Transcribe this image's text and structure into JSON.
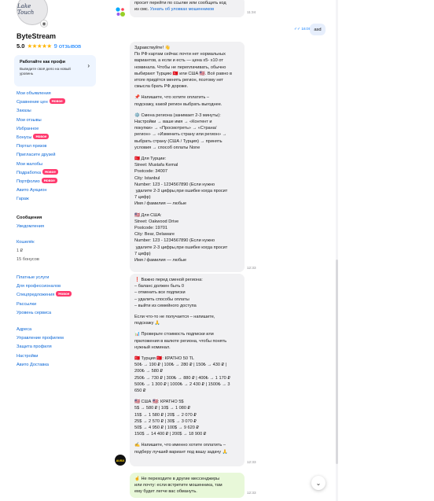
{
  "sidebar": {
    "avatar_text": "Lake Touch",
    "seller_name": "ByteStream",
    "rating_score": "5.0",
    "rating_stars": "★★★★★",
    "reviews": "9 отзывов",
    "promo_title": "Работайте как профи",
    "promo_desc": "Выведите своё дело на новый уровень",
    "menu1": [
      {
        "label": "Мои объявления"
      },
      {
        "label": "Сравнение цен",
        "badge": "Новое"
      },
      {
        "label": "Заказы"
      },
      {
        "label": "Мои отзывы"
      },
      {
        "label": "Избранное"
      },
      {
        "label": "Бонусы",
        "badge": "Новое"
      },
      {
        "label": "Портал призов"
      },
      {
        "label": "Пригласите друзей"
      },
      {
        "label": "Мои жалобы"
      },
      {
        "label": "Подработка",
        "badge": "Новое"
      },
      {
        "label": "Портфолио",
        "badge": "Новое"
      },
      {
        "label": "Авито Аукцион"
      },
      {
        "label": "Гараж"
      }
    ],
    "messages_heading": "Сообщения",
    "notifications": "Уведомления",
    "wallet_heading": "Кошелёк",
    "wallet_balance": "1 ₽",
    "bonuses": "15 бонусов",
    "menu2": [
      {
        "label": "Платные услуги"
      },
      {
        "label": "Для профессионалов"
      },
      {
        "label": "Спецпредложения",
        "badge": "Новое"
      },
      {
        "label": "Рассылки"
      },
      {
        "label": "Уровень сервиса"
      }
    ],
    "menu3": [
      {
        "label": "Адреса"
      },
      {
        "label": "Управление профилем"
      },
      {
        "label": "Защита профиля"
      },
      {
        "label": "Настройки"
      },
      {
        "label": "Авито Доставка"
      }
    ]
  },
  "chat": {
    "top_bubble": {
      "line1": "просит перейти по ссылке или сообщить код",
      "line2_text": "из смс. ",
      "line2_link": "Узнать об уловках мошенников",
      "time": "11:34"
    },
    "out_message": {
      "text": "asd",
      "status": "✓✓ 16:00"
    },
    "main_bubble": {
      "time": "12:33",
      "lines": [
        "Здравствуйте! 👋",
        "По РФ картам сейчас почти нет нормальных",
        "вариантов, а если и есть — цена х5- х10 от",
        "номинала. Чтобы не переплачивать, обычно",
        "выбирают Турцию 🇹🇷 или США 🇺🇸. Всё равно в",
        "итоге придётся менять регион, поэтому нет",
        "смысла брать РФ дороже.",
        "",
        "📌 Напишите, что хотите оплатить –",
        "подскажу, какой регион выбрать выгоднее.",
        "",
        "⚙️ Смена региона (занимает 2-3 минуты):",
        "Настройки → ваше имя → «Контент и",
        "покупки» → «Просмотреть» → «Страна/",
        "регион» → «Изменить страну или регион» →",
        "выбрать страну (США / Турция) → принять",
        "условия → способ оплаты None",
        "",
        "🇹🇷 Для Турции:",
        "Street: Mustafa Kemal",
        "Postcode: 34007",
        "City: Istanbul",
        "Number: 123 - 1234567890 (Если нужно",
        " удалите 2-3 цифры,при ошибке когда просит",
        "7 цифр)",
        "Имя / фамилия — любые",
        "",
        "🇺🇸 Для США:",
        "Street: Oakwood Drive",
        "Postcode: 19701",
        "City: Bear, Delaware",
        "Number: 123 - 1234567890 (Если нужно",
        " удалите 2-3 цифры,при ошибке когда просит",
        "7 цифр)",
        "Имя / фамилия — любые"
      ]
    },
    "second_bubble": {
      "time": "12:33",
      "lines": [
        "❗ Важно перед сменой региона:",
        "– баланс должен быть 0",
        "– отменить все подписки",
        "– удалить способы оплаты",
        "– выйти из семейного доступа",
        "",
        "Если что-то не получается – напишите,",
        "подскажу 🙏",
        "",
        "📊 Проверьте стоимость подписки или",
        "приложения в валюте региона, чтобы понять",
        "нужный номинал.",
        "",
        "🇹🇷 Турция 🇹🇷: КРАТНО 50 TL",
        "50₺ → 190 ₽ | 100₺ → 280 ₽ | 150₺ → 430 ₽ |",
        "200₺ → 580 ₽",
        "250₺ → 730 ₽ | 300₺ → 880 ₽ | 400₺ → 1 170 ₽",
        "500₺ → 1 300 ₽ | 1000₺ → 2 430 ₽ | 1500₺ → 3",
        "650 ₽",
        "",
        "🇺🇸 США 🇺🇸: КРАТНО 5$",
        "5$ → 580 ₽ | 10$ → 1 080 ₽",
        "15$ → 1 580 ₽ | 20$ → 2 070 ₽",
        "25$ → 2 570 ₽ | 30$ → 3 070 ₽",
        "50$ → 4 950 ₽ | 100$ → 9 620 ₽",
        "150$ → 14 400 ₽ | 200$ → 18 900 ₽",
        "",
        "✍️ Напишите, что именно хотите оплатить –",
        "подберу лучший вариант под вашу задачу 🙏"
      ]
    },
    "green_bubble": {
      "time": "12:33",
      "lines": [
        "☝️ Не переходите в другие мессенджеры",
        "или почту: если встретите мошенника, там",
        "ему будет легче вас обмануть."
      ]
    },
    "bottom_avatar_text": "AVBX"
  }
}
